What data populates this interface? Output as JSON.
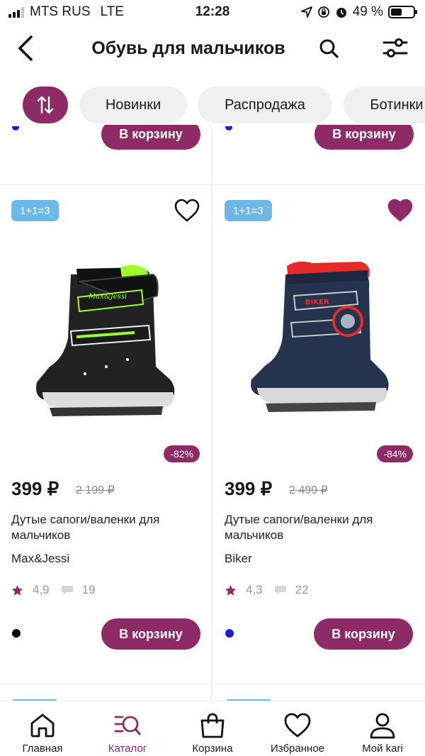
{
  "status_bar": {
    "carrier": "MTS RUS",
    "network": "LTE",
    "time": "12:28",
    "battery": "49 %",
    "battery_level": 0.49
  },
  "header": {
    "title": "Обувь для мальчиков"
  },
  "chips": [
    "Новинки",
    "Распродажа",
    "Ботинки"
  ],
  "top_row": {
    "cart_label": "В корзину"
  },
  "products": [
    {
      "badge": "1+1=3",
      "favorite": false,
      "discount": "-82%",
      "price": "399 ₽",
      "old_price": "2 199 ₽",
      "name": "Дутые сапоги/валенки для мальчиков",
      "brand": "Max&Jessi",
      "rating": "4,9",
      "reviews": "19",
      "color": "#000000",
      "cart_label": "В корзину",
      "shoe_text": "Max&Jessi"
    },
    {
      "badge": "1+1=3",
      "favorite": true,
      "discount": "-84%",
      "price": "399 ₽",
      "old_price": "2 499 ₽",
      "name": "Дутые сапоги/валенки для мальчиков",
      "brand": "Biker",
      "rating": "4,3",
      "reviews": "22",
      "color": "#1a1adf",
      "cart_label": "В корзину",
      "shoe_text": "BIKER"
    }
  ],
  "nav": [
    {
      "label": "Главная",
      "icon": "home-icon",
      "active": false
    },
    {
      "label": "Каталог",
      "icon": "catalog-icon",
      "active": true
    },
    {
      "label": "Корзина",
      "icon": "bag-icon",
      "active": false
    },
    {
      "label": "Избранное",
      "icon": "heart-icon",
      "active": false
    },
    {
      "label": "Мой kari",
      "icon": "profile-icon",
      "active": false
    }
  ],
  "colors": {
    "accent": "#8e2a66",
    "badge": "#6cb8e6"
  }
}
